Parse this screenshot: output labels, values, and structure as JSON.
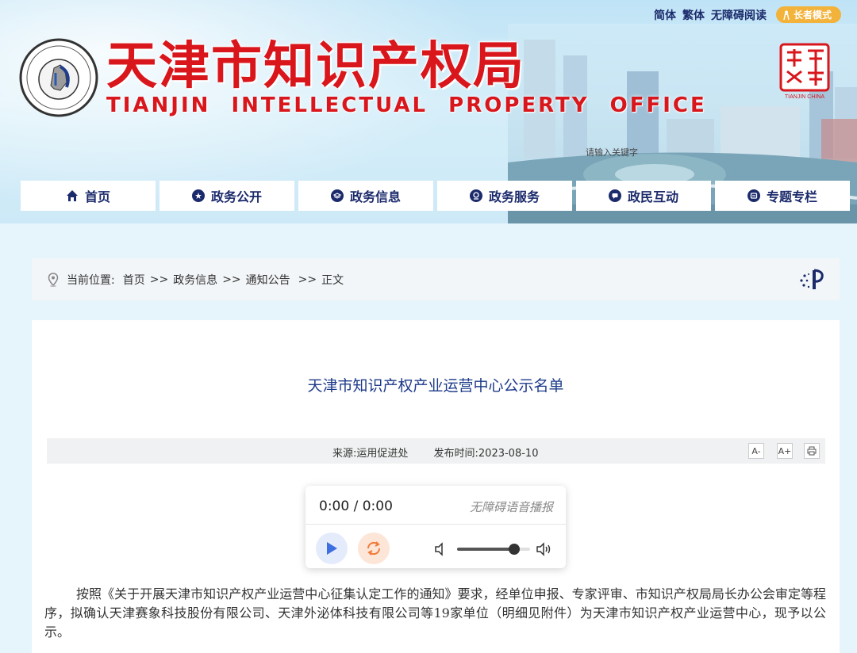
{
  "topbar": {
    "simplified": "简体",
    "traditional": "繁体",
    "accessible": "无障碍阅读",
    "elder_mode": "长者模式"
  },
  "header": {
    "title_cn": "天津市知识产权局",
    "title_en": "TIANJIN INTELLECTUAL PROPERTY OFFICE",
    "seal_right_text": "TIANJIN CHINA",
    "search_placeholder": "请输入关键字",
    "brand_color": "#d8161b"
  },
  "nav": {
    "items": [
      {
        "label": "首页",
        "icon": "home-icon"
      },
      {
        "label": "政务公开",
        "icon": "star-badge-icon"
      },
      {
        "label": "政务信息",
        "icon": "layers-icon"
      },
      {
        "label": "政务服务",
        "icon": "service-icon"
      },
      {
        "label": "政民互动",
        "icon": "chat-icon"
      },
      {
        "label": "专题专栏",
        "icon": "topic-icon"
      }
    ]
  },
  "breadcrumb": {
    "prefix": "当前位置:",
    "items": [
      "首页",
      "政务信息",
      "通知公告",
      "正文"
    ],
    "separator": ">>"
  },
  "article": {
    "title": "天津市知识产权产业运营中心公示名单",
    "source": "来源:运用促进处",
    "publish_time": "发布时间:2023-08-10",
    "font_decrease": "A-",
    "font_increase": "A+",
    "paragraph": "按照《关于开展天津市知识产权产业运营中心征集认定工作的通知》要求，经单位申报、专家评审、市知识产权局局长办公会审定等程序，拟确认天津赛象科技股份有限公司、天津外泌体科技有限公司等19家单位（明细见附件）为天津市知识产权产业运营中心，现予以公示。"
  },
  "player": {
    "time": "0:00 / 0:00",
    "label": "无障碍语音播报",
    "volume": 0.78
  }
}
